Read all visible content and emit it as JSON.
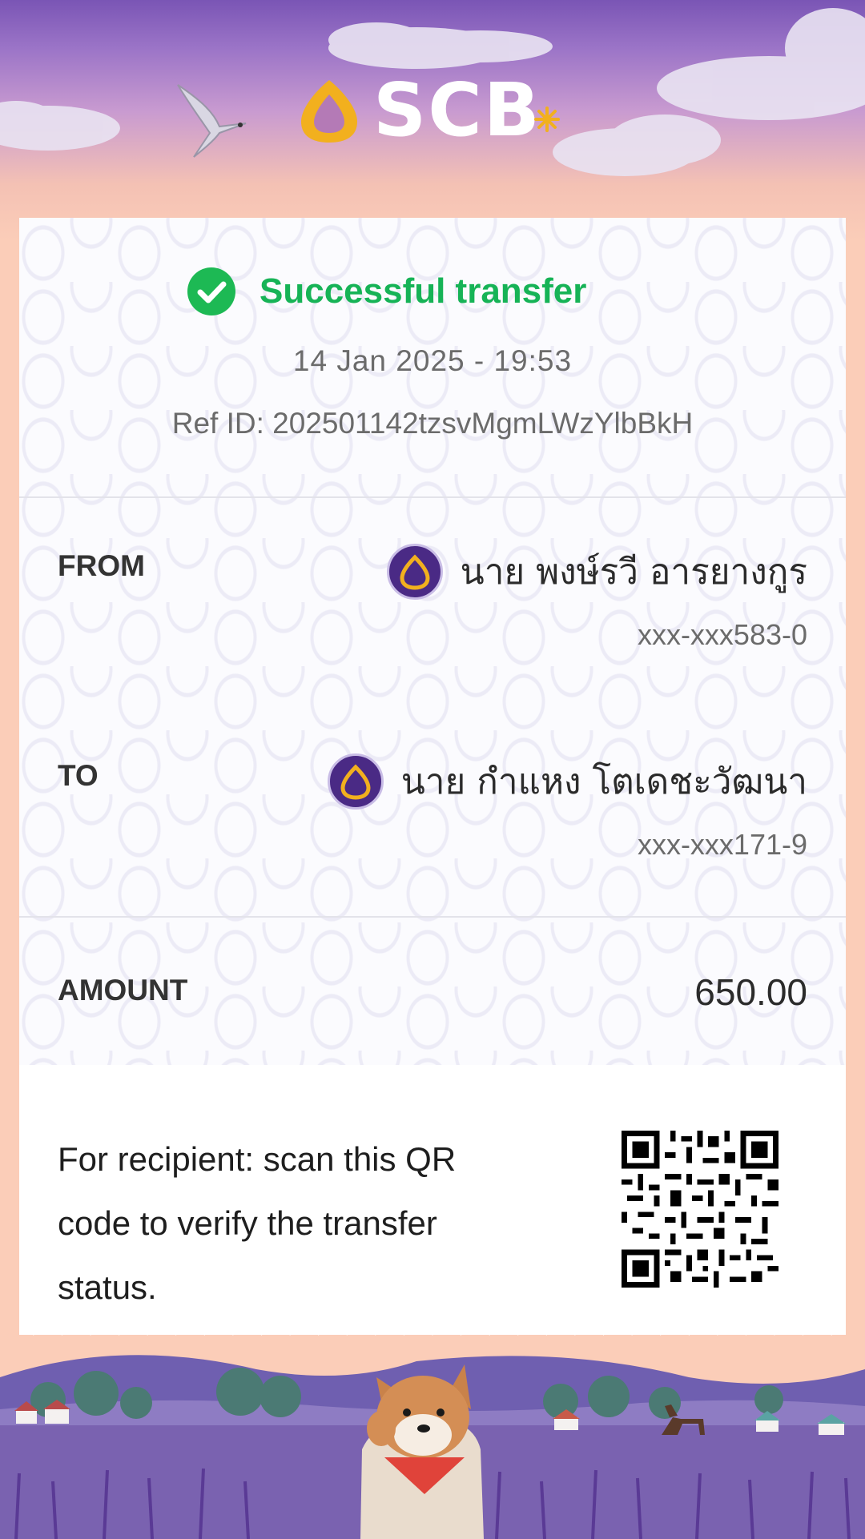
{
  "header": {
    "brand": "SCB",
    "colors": {
      "sky_top": "#7a55b5",
      "sky_bottom": "#fbcdb8",
      "logo_gold": "#f2b01e"
    }
  },
  "status": {
    "title": "Successful transfer",
    "icon": "check-circle-icon",
    "color": "#16b356"
  },
  "transaction": {
    "datetime": "14 Jan 2025 - 19:53",
    "ref": "Ref ID: 202501142tzsvMgmLWzYlbBkH"
  },
  "from": {
    "label": "FROM",
    "name": "นาย พงษ์รวี อารยางกูร",
    "account": "xxx-xxx583-0",
    "bank_icon": "scb-bank-icon"
  },
  "to": {
    "label": "TO",
    "name": "นาย กำแหง โตเดชะวัฒนา",
    "account": "xxx-xxx171-9",
    "bank_icon": "scb-bank-icon"
  },
  "amount": {
    "label": "AMOUNT",
    "value": "650.00"
  },
  "verify": {
    "caption": "For recipient: scan this QR code to verify the transfer status.",
    "qr_icon": "qr-code-icon"
  }
}
